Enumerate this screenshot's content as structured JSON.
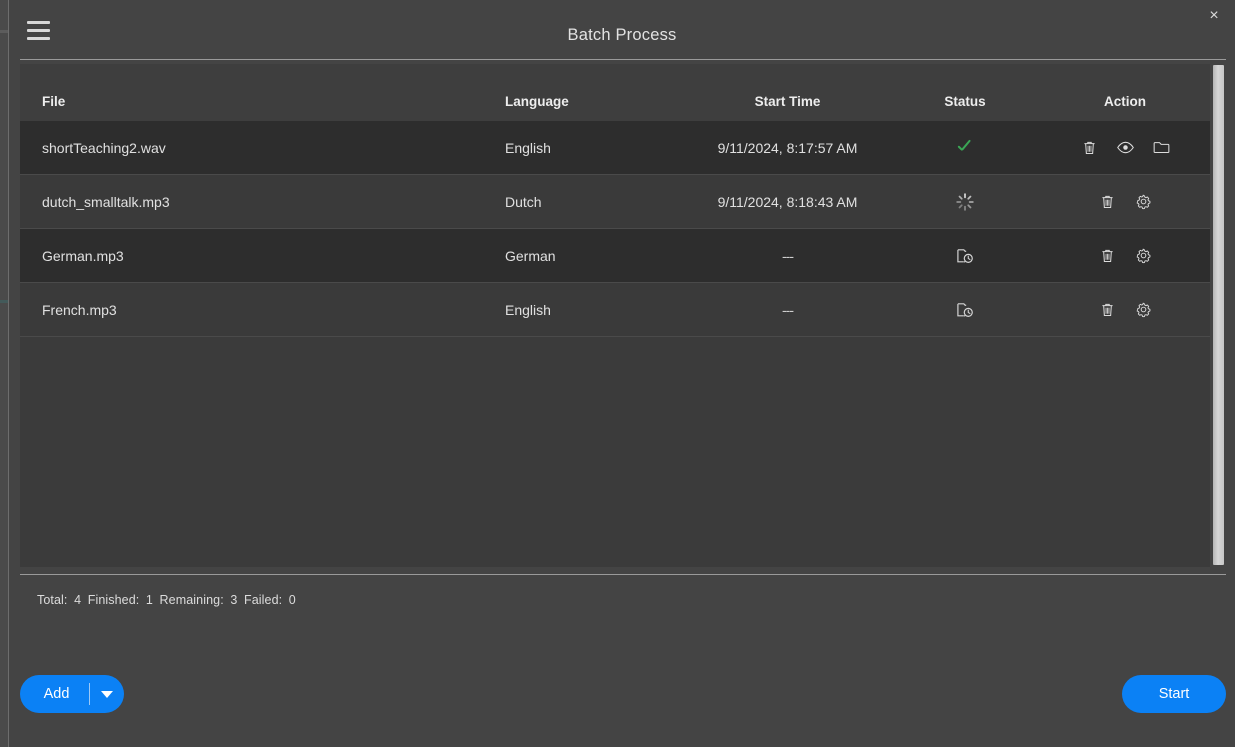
{
  "window": {
    "title": "Batch Process",
    "menu_icon": "hamburger-icon",
    "close_label": "×"
  },
  "table": {
    "columns": [
      "File",
      "Language",
      "Start Time",
      "Status",
      "Action"
    ],
    "rows": [
      {
        "file": "shortTeaching2.wav",
        "language": "English",
        "start_time": "9/11/2024, 8:17:57 AM",
        "status": "finished",
        "status_icon": "check-icon",
        "actions": [
          "delete-icon",
          "eye-icon",
          "folder-icon"
        ]
      },
      {
        "file": "dutch_smalltalk.mp3",
        "language": "Dutch",
        "start_time": "9/11/2024, 8:18:43 AM",
        "status": "processing",
        "status_icon": "spinner-icon",
        "actions": [
          "delete-icon",
          "gear-icon"
        ]
      },
      {
        "file": "German.mp3",
        "language": "German",
        "start_time": "---",
        "status": "pending",
        "status_icon": "pending-clock-icon",
        "actions": [
          "delete-icon",
          "gear-icon"
        ]
      },
      {
        "file": "French.mp3",
        "language": "English",
        "start_time": "---",
        "status": "pending",
        "status_icon": "pending-clock-icon",
        "actions": [
          "delete-icon",
          "gear-icon"
        ]
      }
    ]
  },
  "summary": {
    "total_label": "Total:",
    "total_value": "4",
    "finished_label": "Finished:",
    "finished_value": "1",
    "remaining_label": "Remaining:",
    "remaining_value": "3",
    "failed_label": "Failed:",
    "failed_value": "0"
  },
  "buttons": {
    "add_label": "Add",
    "start_label": "Start"
  },
  "colors": {
    "accent": "#0b81f5",
    "success": "#3aa655",
    "window_bg": "#444444",
    "row_odd": "#2d2d2d",
    "row_even": "#3a3a3a",
    "header_bg": "#3e3e3e"
  }
}
